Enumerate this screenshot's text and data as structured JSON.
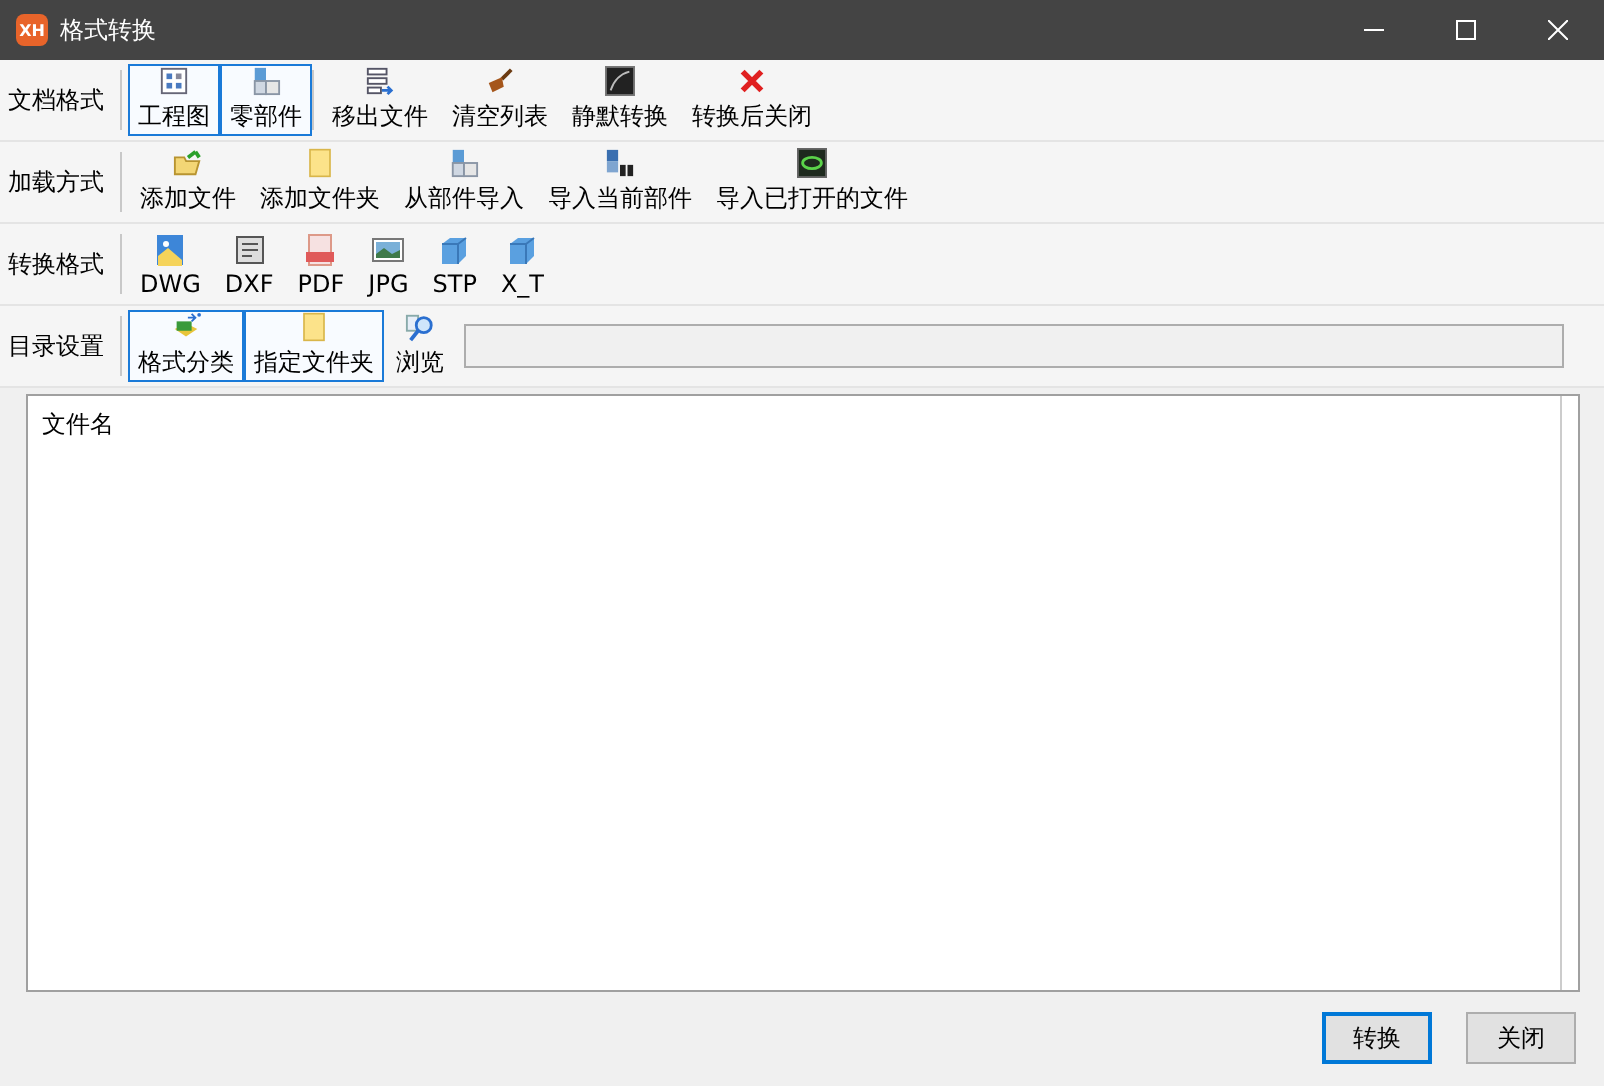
{
  "window": {
    "title": "格式转换",
    "logo": "XH"
  },
  "toolbar_rows": [
    {
      "label": "文档格式",
      "groups": [
        [
          {
            "label": "工程图",
            "kind": "toggle",
            "selected": true
          },
          {
            "label": "零部件",
            "kind": "toggle",
            "selected": true
          }
        ],
        [
          {
            "label": "移出文件",
            "kind": "action"
          },
          {
            "label": "清空列表",
            "kind": "action"
          },
          {
            "label": "静默转换",
            "kind": "action"
          },
          {
            "label": "转换后关闭",
            "kind": "action"
          }
        ]
      ]
    },
    {
      "label": "加载方式",
      "groups": [
        [
          {
            "label": "添加文件",
            "kind": "action"
          },
          {
            "label": "添加文件夹",
            "kind": "action"
          },
          {
            "label": "从部件导入",
            "kind": "action"
          },
          {
            "label": "导入当前部件",
            "kind": "action"
          },
          {
            "label": "导入已打开的文件",
            "kind": "action"
          }
        ]
      ]
    },
    {
      "label": "转换格式",
      "groups": [
        [
          {
            "label": "DWG",
            "kind": "action"
          },
          {
            "label": "DXF",
            "kind": "action"
          },
          {
            "label": "PDF",
            "kind": "action"
          },
          {
            "label": "JPG",
            "kind": "action"
          },
          {
            "label": "STP",
            "kind": "action"
          },
          {
            "label": "X_T",
            "kind": "action"
          }
        ]
      ]
    },
    {
      "label": "目录设置",
      "groups": [
        [
          {
            "label": "格式分类",
            "kind": "toggle",
            "selected": true
          },
          {
            "label": "指定文件夹",
            "kind": "toggle",
            "selected": true
          },
          {
            "label": "浏览",
            "kind": "action"
          }
        ]
      ],
      "path_field": {
        "kind": "field"
      }
    }
  ],
  "file_list": {
    "columns": [
      "文件名"
    ]
  },
  "buttons": [
    {
      "label": "转换",
      "selected": true
    },
    {
      "label": "关闭",
      "selected": false
    }
  ]
}
